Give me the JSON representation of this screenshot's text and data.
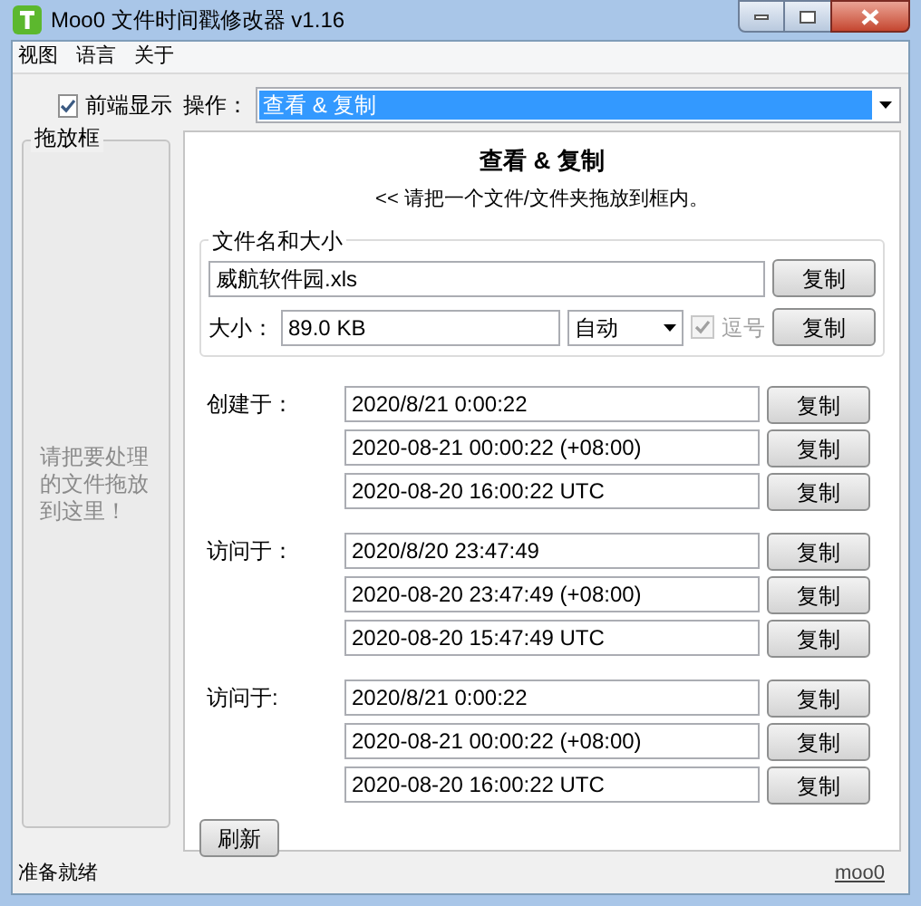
{
  "window": {
    "title": "Moo0 文件时间戳修改器 v1.16"
  },
  "menu": [
    "视图",
    "语言",
    "关于"
  ],
  "always_on_top": {
    "label": "前端显示",
    "checked": true
  },
  "operation": {
    "label": "操作：",
    "value": "查看 & 复制"
  },
  "drop_box": {
    "title": "拖放框",
    "hint": "请把要处理的文件拖放到这里！"
  },
  "panel": {
    "title": "查看 & 复制",
    "subtitle": "<< 请把一个文件/文件夹拖放到框内。",
    "file_group": {
      "title": "文件名和大小",
      "filename": "威航软件园.xls",
      "copy_button": "复制",
      "size_label": "大小：",
      "size": "89.0 KB",
      "unit": "自动",
      "comma": {
        "label": "逗号",
        "checked": true,
        "disabled": true
      },
      "size_copy_button": "复制"
    },
    "time_groups": [
      {
        "label": "创建于：",
        "rows": [
          {
            "value": "2020/8/21 0:00:22",
            "button": "复制"
          },
          {
            "value": "2020-08-21 00:00:22 (+08:00)",
            "button": "复制"
          },
          {
            "value": "2020-08-20 16:00:22 UTC",
            "button": "复制"
          }
        ]
      },
      {
        "label": "访问于：",
        "rows": [
          {
            "value": "2020/8/20 23:47:49",
            "button": "复制"
          },
          {
            "value": "2020-08-20 23:47:49 (+08:00)",
            "button": "复制"
          },
          {
            "value": "2020-08-20 15:47:49 UTC",
            "button": "复制"
          }
        ]
      },
      {
        "label": "访问于:",
        "rows": [
          {
            "value": "2020/8/21 0:00:22",
            "button": "复制"
          },
          {
            "value": "2020-08-21 00:00:22 (+08:00)",
            "button": "复制"
          },
          {
            "value": "2020-08-20 16:00:22 UTC",
            "button": "复制"
          }
        ]
      }
    ],
    "refresh_button": "刷新"
  },
  "status_bar": {
    "text": "准备就绪",
    "link": "moo0"
  }
}
